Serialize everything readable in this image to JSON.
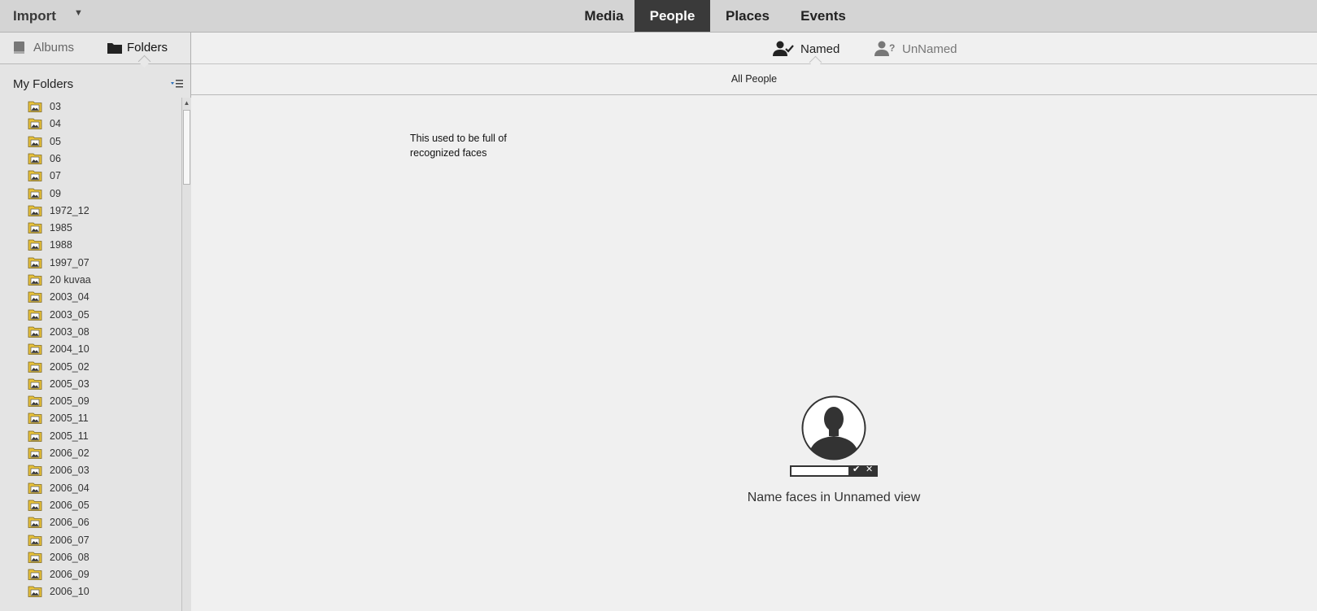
{
  "topbar": {
    "import_label": "Import",
    "tabs": [
      {
        "label": "Media",
        "active": false
      },
      {
        "label": "People",
        "active": true
      },
      {
        "label": "Places",
        "active": false
      },
      {
        "label": "Events",
        "active": false
      }
    ]
  },
  "sidebar": {
    "tabs": [
      {
        "label": "Albums",
        "icon": "album-book-icon",
        "active": false
      },
      {
        "label": "Folders",
        "icon": "folder-icon",
        "active": true
      }
    ],
    "section_title": "My Folders",
    "folders": [
      "03",
      "04",
      "05",
      "06",
      "07",
      "09",
      "1972_12",
      "1985",
      "1988",
      "1997_07",
      "20 kuvaa",
      "2003_04",
      "2003_05",
      "2003_08",
      "2004_10",
      "2005_02",
      "2005_03",
      "2005_09",
      "2005_11",
      "2005_11",
      "2006_02",
      "2006_03",
      "2006_04",
      "2006_05",
      "2006_06",
      "2006_07",
      "2006_08",
      "2006_09",
      "2006_10"
    ]
  },
  "main": {
    "named_label": "Named",
    "unnamed_label": "UnNamed",
    "all_people": "All People",
    "note": "This used to be full of recognized faces",
    "empty_message": "Name faces in Unnamed view"
  },
  "colors": {
    "active_tab_bg": "#3a3a3a",
    "folder_yellow": "#e8c23a"
  }
}
